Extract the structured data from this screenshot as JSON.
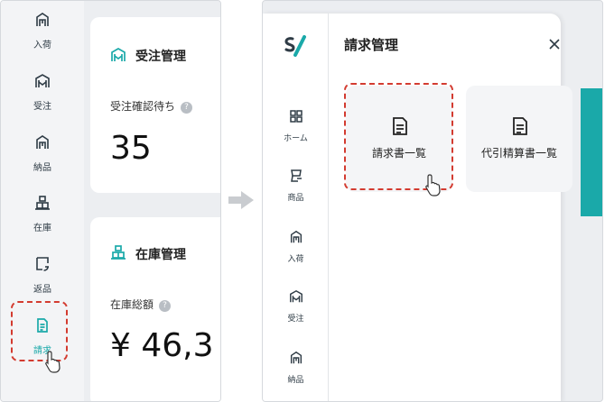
{
  "left_screen": {
    "nav": [
      {
        "label": "入荷",
        "icon": "inbound-icon"
      },
      {
        "label": "受注",
        "icon": "orders-icon"
      },
      {
        "label": "納品",
        "icon": "delivery-icon"
      },
      {
        "label": "在庫",
        "icon": "inventory-icon"
      },
      {
        "label": "返品",
        "icon": "return-icon"
      },
      {
        "label": "請求",
        "icon": "billing-icon",
        "highlighted": true,
        "color": "#1aa9a9"
      }
    ],
    "order_card": {
      "title": "受注管理",
      "subtitle": "受注確認待ち",
      "value": "35"
    },
    "stock_card": {
      "title": "在庫管理",
      "subtitle": "在庫総額",
      "value": "¥ 46,3"
    },
    "help_glyph": "?"
  },
  "right_screen": {
    "panel_title": "請求管理",
    "close_glyph": "✕",
    "nav": [
      {
        "label": "ホーム",
        "icon": "home-grid-icon"
      },
      {
        "label": "商品",
        "icon": "product-icon"
      },
      {
        "label": "入荷",
        "icon": "inbound-icon"
      },
      {
        "label": "受注",
        "icon": "orders-icon"
      },
      {
        "label": "納品",
        "icon": "delivery-icon"
      }
    ],
    "menu": [
      {
        "label": "請求書一覧",
        "icon": "invoice-icon",
        "highlighted": true
      },
      {
        "label": "代引精算書一覧",
        "icon": "invoice-icon"
      }
    ]
  },
  "colors": {
    "accent": "#1aa9a9",
    "highlight": "#d33b30",
    "icon": "#2e3b45"
  }
}
